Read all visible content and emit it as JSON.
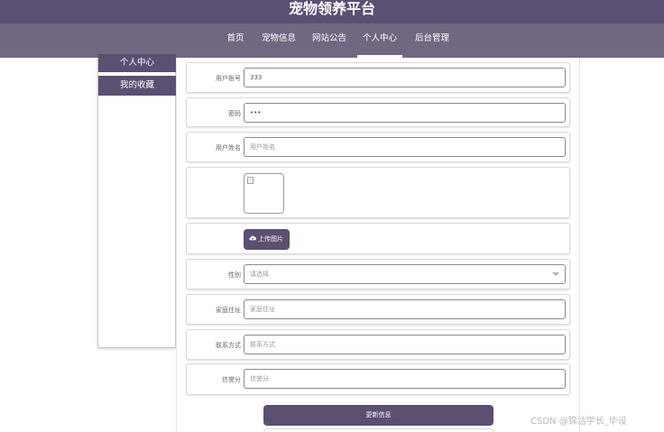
{
  "site": {
    "title": "宠物领养平台"
  },
  "nav": {
    "items": [
      {
        "label": "首页"
      },
      {
        "label": "宠物信息"
      },
      {
        "label": "网站公告"
      },
      {
        "label": "个人中心",
        "active": true
      },
      {
        "label": "后台管理"
      }
    ]
  },
  "sidebar": {
    "items": [
      {
        "label": "个人中心"
      },
      {
        "label": "我的收藏"
      }
    ]
  },
  "form": {
    "account": {
      "label": "用户账号",
      "value": "333"
    },
    "password": {
      "label": "密码",
      "value": "•••"
    },
    "name": {
      "label": "用户姓名",
      "placeholder": "用户姓名"
    },
    "upload": {
      "label": "上传图片"
    },
    "gender": {
      "label": "性别",
      "placeholder": "请选择"
    },
    "address": {
      "label": "家庭住址",
      "placeholder": "家庭住址"
    },
    "contact": {
      "label": "联系方式",
      "placeholder": "联系方式"
    },
    "credit": {
      "label": "信誉分",
      "placeholder": "信誉分"
    },
    "submit_label": "更新信息"
  },
  "watermark": "CSDN @锦沽学长_毕设",
  "colors": {
    "primary": "#5b4f72",
    "nav": "#6f6880"
  }
}
